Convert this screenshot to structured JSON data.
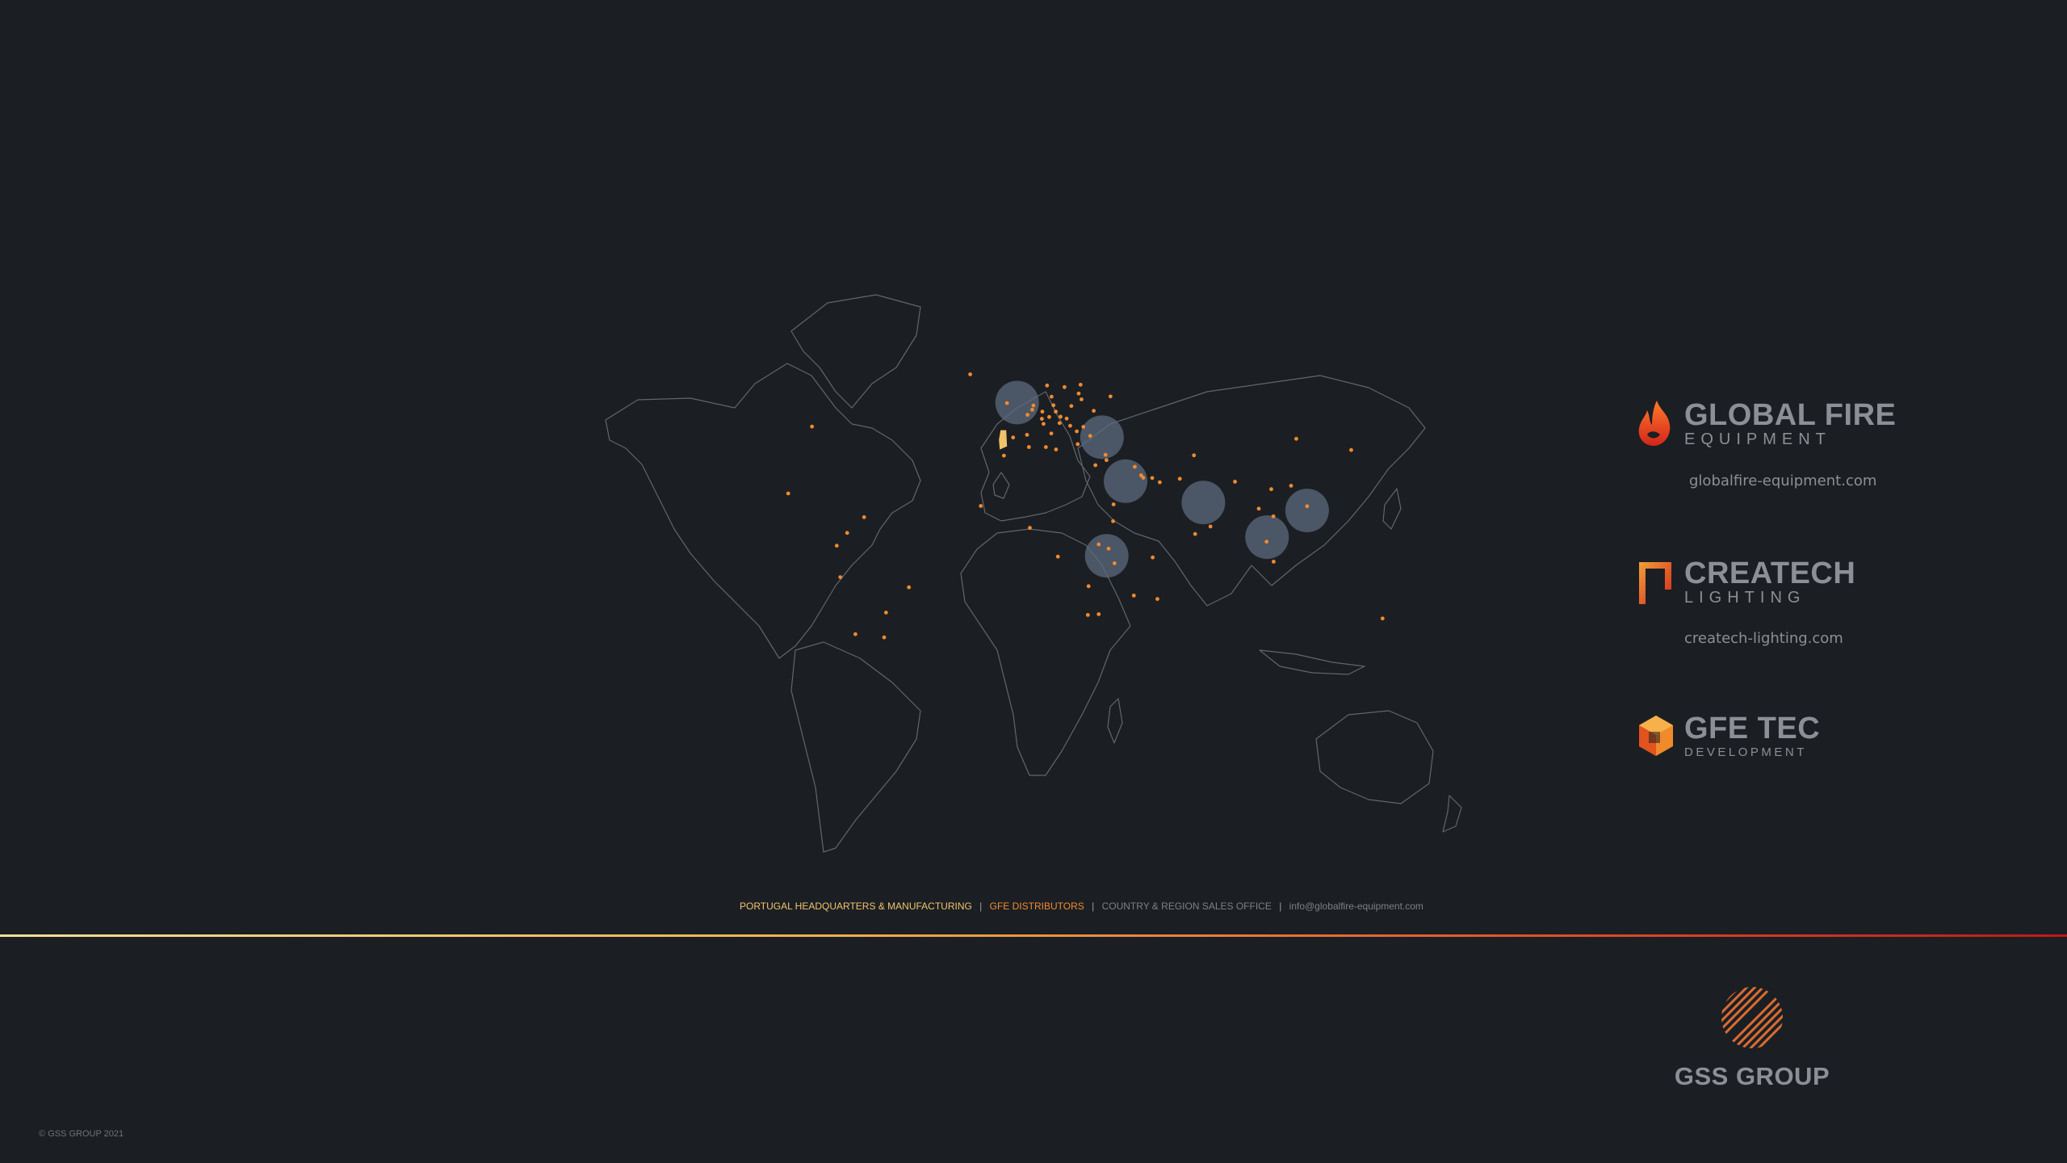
{
  "legend": {
    "hq": "PORTUGAL HEADQUARTERS & MANUFACTURING",
    "sep1": "|",
    "distributors": "GFE DISTRIBUTORS",
    "sep2": "|",
    "sales_office": "COUNTRY & REGION SALES OFFICE",
    "sep3": "|",
    "email": "info@globalfire-equipment.com"
  },
  "brands": {
    "gfe": {
      "name": "GLOBAL FIRE",
      "sub": "EQUIPMENT",
      "url": "globalfire-equipment.com"
    },
    "createch": {
      "name": "CREATECH",
      "sub": "LIGHTING",
      "url": "createch-lighting.com"
    },
    "gfetec": {
      "name": "GFE TEC",
      "sub": "DEVELOPMENT"
    }
  },
  "group": {
    "name": "GSS GROUP"
  },
  "copyright": "© GSS GROUP 2021",
  "colors": {
    "background": "#1b1f23",
    "map_outline": "#6a6e74",
    "distributor_dot": "#f28a2e",
    "hq_marker": "#f2c36b",
    "sales_office_circle": "#5c6a7e"
  },
  "map": {
    "headquarters": {
      "name": "Portugal",
      "lat": 39.5,
      "lon": -8.0
    },
    "sales_offices": [
      {
        "name": "United Kingdom",
        "lat": 53.5,
        "lon": -2.0
      },
      {
        "name": "Turkey",
        "lat": 40.5,
        "lon": 34.0
      },
      {
        "name": "Saudi Arabia",
        "lat": 24.0,
        "lon": 44.0
      },
      {
        "name": "India",
        "lat": 16.0,
        "lon": 77.0
      },
      {
        "name": "Malaysia",
        "lat": 3.0,
        "lon": 104.0
      },
      {
        "name": "Philippines",
        "lat": 13.0,
        "lon": 121.0
      },
      {
        "name": "Kenya",
        "lat": -4.0,
        "lon": 36.0
      }
    ],
    "distributors": [
      {
        "lat": 64.1,
        "lon": -21.9
      },
      {
        "lat": 44.5,
        "lon": -89.0
      },
      {
        "lat": 19.4,
        "lon": -99.1
      },
      {
        "lat": 4.6,
        "lon": -74.1
      },
      {
        "lat": -12.0,
        "lon": -77.0
      },
      {
        "lat": -15.8,
        "lon": -47.9
      },
      {
        "lat": -25.3,
        "lon": -57.6
      },
      {
        "lat": -34.6,
        "lon": -58.4
      },
      {
        "lat": -33.4,
        "lon": -70.6
      },
      {
        "lat": -0.2,
        "lon": -78.5
      },
      {
        "lat": 10.5,
        "lon": -66.9
      },
      {
        "lat": 59.3,
        "lon": 18.1
      },
      {
        "lat": 60.2,
        "lon": 24.9
      },
      {
        "lat": 55.7,
        "lon": 12.6
      },
      {
        "lat": 59.9,
        "lon": 10.7
      },
      {
        "lat": 52.4,
        "lon": 4.9
      },
      {
        "lat": 50.8,
        "lon": 4.4
      },
      {
        "lat": 48.9,
        "lon": 2.4
      },
      {
        "lat": 52.5,
        "lon": 13.4
      },
      {
        "lat": 50.1,
        "lon": 8.7
      },
      {
        "lat": 48.1,
        "lon": 11.6
      },
      {
        "lat": 47.4,
        "lon": 8.5
      },
      {
        "lat": 48.2,
        "lon": 16.4
      },
      {
        "lat": 50.1,
        "lon": 14.4
      },
      {
        "lat": 52.2,
        "lon": 21.0
      },
      {
        "lat": 47.5,
        "lon": 19.0
      },
      {
        "lat": 45.8,
        "lon": 16.0
      },
      {
        "lat": 44.8,
        "lon": 20.5
      },
      {
        "lat": 44.4,
        "lon": 26.1
      },
      {
        "lat": 42.7,
        "lon": 23.3
      },
      {
        "lat": 41.9,
        "lon": 12.5
      },
      {
        "lat": 45.5,
        "lon": 9.2
      },
      {
        "lat": 40.4,
        "lon": -3.7
      },
      {
        "lat": 41.4,
        "lon": 2.2
      },
      {
        "lat": 37.9,
        "lon": 23.7
      },
      {
        "lat": 56.9,
        "lon": 24.1
      },
      {
        "lat": 54.7,
        "lon": 25.3
      },
      {
        "lat": 50.4,
        "lon": 30.5
      },
      {
        "lat": 55.8,
        "lon": 37.6
      },
      {
        "lat": 53.3,
        "lon": -6.3
      },
      {
        "lat": 35.9,
        "lon": 14.5
      },
      {
        "lat": 41.0,
        "lon": 29.0
      },
      {
        "lat": 33.9,
        "lon": 35.5
      },
      {
        "lat": 31.9,
        "lon": 35.9
      },
      {
        "lat": 30.0,
        "lon": 31.2
      },
      {
        "lat": 25.3,
        "lon": 51.5
      },
      {
        "lat": 25.2,
        "lon": 55.3
      },
      {
        "lat": 23.6,
        "lon": 58.5
      },
      {
        "lat": 29.4,
        "lon": 47.9
      },
      {
        "lat": 26.2,
        "lon": 50.6
      },
      {
        "lat": 33.7,
        "lon": 73.0
      },
      {
        "lat": 24.9,
        "lon": 67.0
      },
      {
        "lat": 23.8,
        "lon": 90.4
      },
      {
        "lat": 13.7,
        "lon": 100.5
      },
      {
        "lat": 21.0,
        "lon": 105.8
      },
      {
        "lat": 10.8,
        "lon": 106.7
      },
      {
        "lat": 1.3,
        "lon": 103.8
      },
      {
        "lat": -6.2,
        "lon": 106.8
      },
      {
        "lat": 14.6,
        "lon": 121.0
      },
      {
        "lat": 35.7,
        "lon": 139.7
      },
      {
        "lat": 39.9,
        "lon": 116.4
      },
      {
        "lat": 22.3,
        "lon": 114.2
      },
      {
        "lat": 33.6,
        "lon": -7.6
      },
      {
        "lat": 36.8,
        "lon": 10.2
      },
      {
        "lat": 36.8,
        "lon": 3.0
      },
      {
        "lat": 14.7,
        "lon": -17.4
      },
      {
        "lat": 6.5,
        "lon": 3.4
      },
      {
        "lat": 9.0,
        "lon": 38.7
      },
      {
        "lat": -1.3,
        "lon": 36.8
      },
      {
        "lat": 0.3,
        "lon": 32.6
      },
      {
        "lat": -6.8,
        "lon": 39.3
      },
      {
        "lat": -4.3,
        "lon": 15.3
      },
      {
        "lat": -15.4,
        "lon": 28.3
      },
      {
        "lat": -26.2,
        "lon": 28.0
      },
      {
        "lat": -18.9,
        "lon": 47.5
      },
      {
        "lat": -20.2,
        "lon": 57.5
      },
      {
        "lat": -4.6,
        "lon": 55.5
      },
      {
        "lat": -25.9,
        "lon": 32.6
      },
      {
        "lat": 15.3,
        "lon": 38.9
      },
      {
        "lat": 4.2,
        "lon": 73.5
      },
      {
        "lat": 7.0,
        "lon": 80.0
      },
      {
        "lat": -27.5,
        "lon": 153.0
      }
    ]
  }
}
